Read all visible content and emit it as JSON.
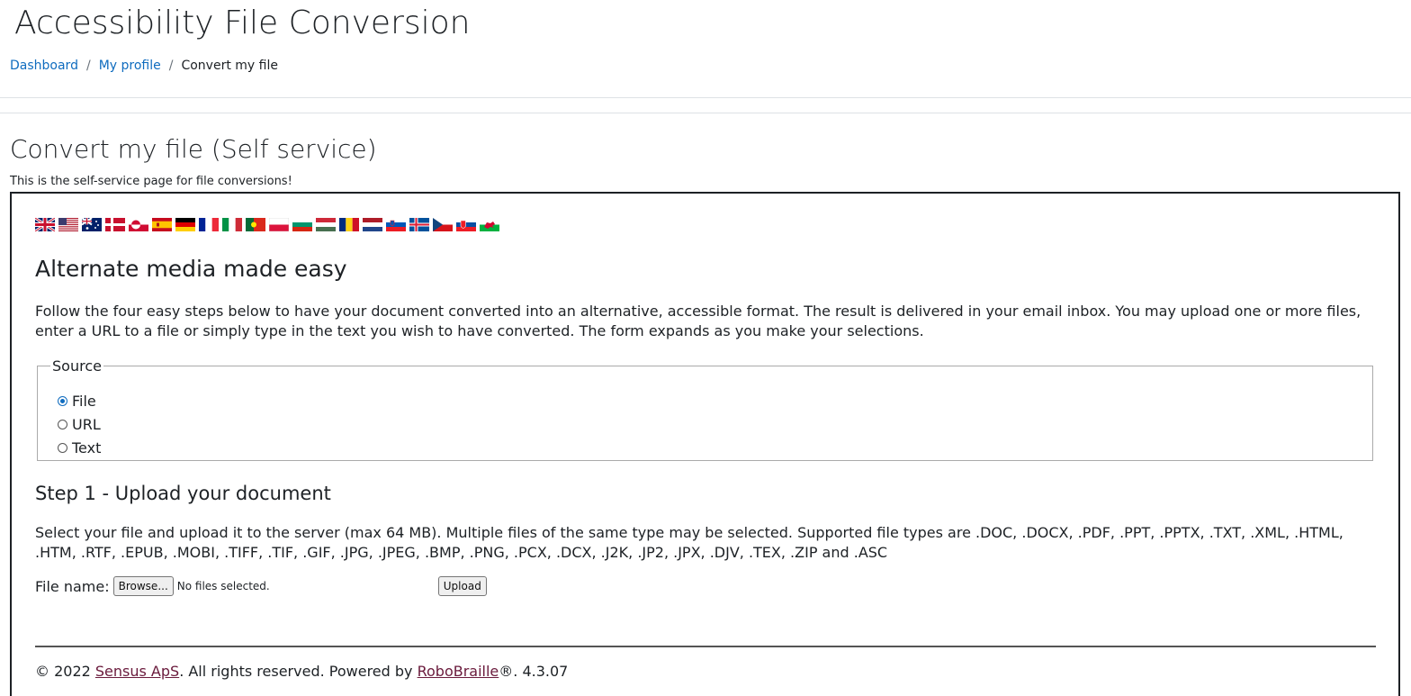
{
  "header": {
    "title": "Accessibility File Conversion",
    "breadcrumb": [
      {
        "label": "Dashboard"
      },
      {
        "label": "My profile"
      },
      {
        "label": "Convert my file"
      }
    ],
    "separator": "/"
  },
  "main": {
    "title": "Convert my file (Self service)",
    "intro": "This is the self-service page for file conversions!"
  },
  "panel": {
    "languages": [
      {
        "icon": "flag-uk-icon"
      },
      {
        "icon": "flag-us-icon"
      },
      {
        "icon": "flag-australia-icon"
      },
      {
        "icon": "flag-denmark-icon"
      },
      {
        "icon": "flag-greenland-icon"
      },
      {
        "icon": "flag-spain-icon"
      },
      {
        "icon": "flag-germany-icon"
      },
      {
        "icon": "flag-france-icon"
      },
      {
        "icon": "flag-italy-icon"
      },
      {
        "icon": "flag-portugal-icon"
      },
      {
        "icon": "flag-poland-icon"
      },
      {
        "icon": "flag-bulgaria-icon"
      },
      {
        "icon": "flag-hungary-icon"
      },
      {
        "icon": "flag-romania-icon"
      },
      {
        "icon": "flag-netherlands-icon"
      },
      {
        "icon": "flag-slovenia-icon"
      },
      {
        "icon": "flag-iceland-icon"
      },
      {
        "icon": "flag-czech-icon"
      },
      {
        "icon": "flag-slovakia-icon"
      },
      {
        "icon": "flag-wales-icon"
      }
    ],
    "heading": "Alternate media made easy",
    "description": "Follow the four easy steps below to have your document converted into an alternative, accessible format. The result is delivered in your email inbox. You may upload one or more files, enter a URL to a file or simply type in the text you wish to have converted. The form expands as you make your selections.",
    "source": {
      "legend": "Source",
      "options": [
        {
          "label": "File",
          "checked": true
        },
        {
          "label": "URL",
          "checked": false
        },
        {
          "label": "Text",
          "checked": false
        }
      ]
    },
    "step1": {
      "heading": "Step 1 - Upload your document",
      "description": "Select your file and upload it to the server (max 64 MB). Multiple files of the same type may be selected. Supported file types are .DOC, .DOCX, .PDF, .PPT, .PPTX, .TXT, .XML, .HTML, .HTM, .RTF, .EPUB, .MOBI, .TIFF, .TIF, .GIF, .JPG, .JPEG, .BMP, .PNG, .PCX, .DCX, .J2K, .JP2, .JPX, .DJV, .TEX, .ZIP and .ASC",
      "file_label": "File name:",
      "browse_label": "Browse...",
      "file_status": "No files selected.",
      "upload_label": "Upload"
    },
    "footer": {
      "prefix": "© 2022 ",
      "company": "Sensus ApS",
      "middle": ". All rights reserved. Powered by ",
      "product": "RoboBraille",
      "suffix": "®. 4.3.07"
    }
  },
  "colors": {
    "link": "#0f6cbf",
    "footer_link": "#6a1a3c",
    "radio_accent": "#0f6cbf"
  }
}
